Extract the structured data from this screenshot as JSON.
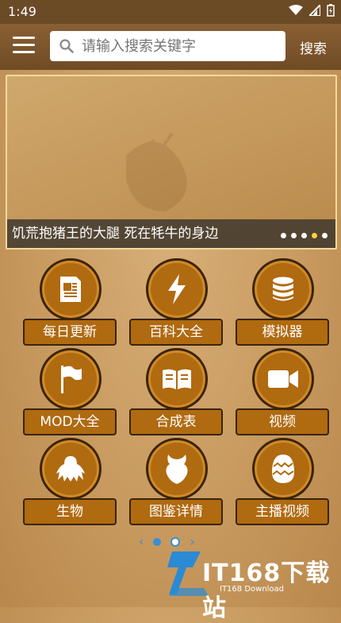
{
  "status_bar": {
    "time": "1:49"
  },
  "header": {
    "search_placeholder": "请输入搜索关键字",
    "search_button": "搜索"
  },
  "banner": {
    "caption": "饥荒抱猪王的大腿 死在牦牛的身边",
    "slide_count": 5,
    "active_slide": 4
  },
  "tiles": [
    {
      "label": "每日更新",
      "icon": "document-icon"
    },
    {
      "label": "百科大全",
      "icon": "lightning-icon"
    },
    {
      "label": "模拟器",
      "icon": "database-icon"
    },
    {
      "label": "MOD大全",
      "icon": "flag-icon"
    },
    {
      "label": "合成表",
      "icon": "book-icon"
    },
    {
      "label": "视频",
      "icon": "video-camera-icon"
    },
    {
      "label": "生物",
      "icon": "creature-icon"
    },
    {
      "label": "图鉴详情",
      "icon": "beast-head-icon"
    },
    {
      "label": "主播视频",
      "icon": "egg-icon"
    }
  ],
  "pager": {
    "pages": 2,
    "active_page": 1
  },
  "watermark": {
    "main": "IT168下载站",
    "sub": "IT168 Download"
  }
}
